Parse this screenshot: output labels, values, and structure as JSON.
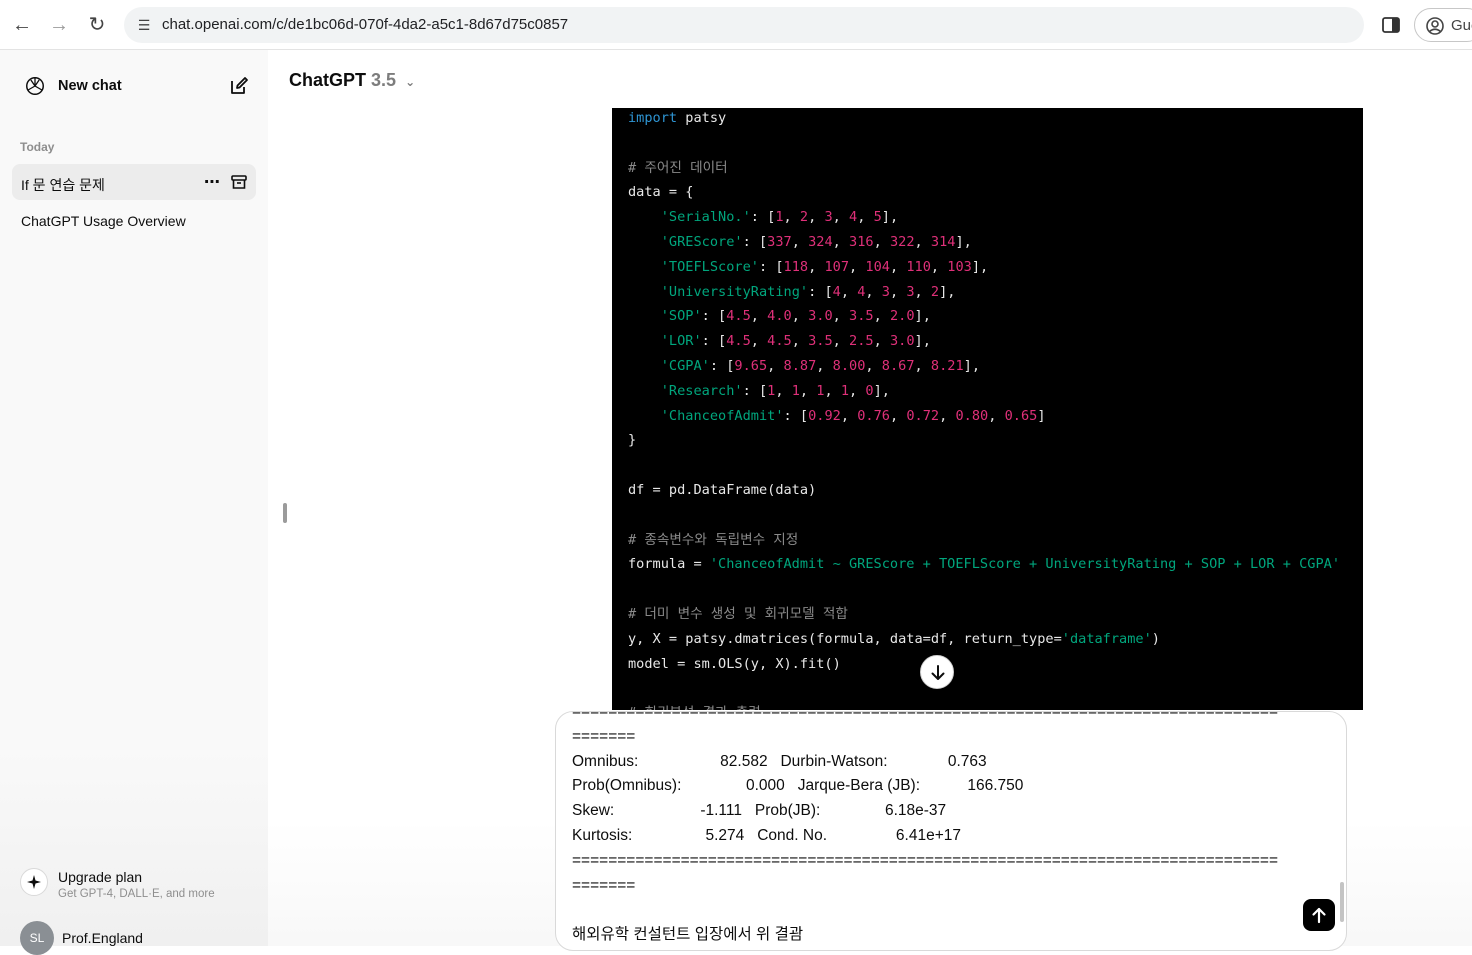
{
  "browser": {
    "url": "chat.openai.com/c/de1bc06d-070f-4da2-a5c1-8d67d75c0857",
    "profile_label": "Gue"
  },
  "sidebar": {
    "new_chat_label": "New chat",
    "section_today": "Today",
    "conversations": [
      {
        "title": "If 문 연습 문제"
      },
      {
        "title": "ChatGPT Usage Overview"
      }
    ],
    "upgrade_title": "Upgrade plan",
    "upgrade_sub": "Get GPT-4, DALL·E, and more",
    "user_initials": "SL",
    "user_name": "Prof.England"
  },
  "header": {
    "model_name": "ChatGPT",
    "model_version": "3.5"
  },
  "code": {
    "lines": [
      "import patsy",
      "",
      "# 주어진 데이터",
      "data = {",
      "    'SerialNo.': [1, 2, 3, 4, 5],",
      "    'GREScore': [337, 324, 316, 322, 314],",
      "    'TOEFLScore': [118, 107, 104, 110, 103],",
      "    'UniversityRating': [4, 4, 3, 3, 2],",
      "    'SOP': [4.5, 4.0, 3.0, 3.5, 2.0],",
      "    'LOR': [4.5, 4.5, 3.5, 2.5, 3.0],",
      "    'CGPA': [9.65, 8.87, 8.00, 8.67, 8.21],",
      "    'Research': [1, 1, 1, 1, 0],",
      "    'ChanceofAdmit': [0.92, 0.76, 0.72, 0.80, 0.65]",
      "}",
      "",
      "df = pd.DataFrame(data)",
      "",
      "# 종속변수와 독립변수 지정",
      "formula = 'ChanceofAdmit ~ GREScore + TOEFLScore + UniversityRating + SOP + LOR + CGPA'",
      "",
      "# 더미 변수 생성 및 회귀모델 적합",
      "y, X = patsy.dmatrices(formula, data=df, return_type='dataframe')",
      "model = sm.OLS(y, X).fit()",
      "",
      "# 회귀분석 결과 출력"
    ]
  },
  "composer": {
    "lines": [
      "==============================================================================",
      "=======",
      "Omnibus:                   82.582   Durbin-Watson:              0.763",
      "Prob(Omnibus):               0.000   Jarque-Bera (JB):           166.750",
      "Skew:                    -1.111   Prob(JB):               6.18e-37",
      "Kurtosis:                 5.274   Cond. No.                6.41e+17",
      "==============================================================================",
      "=======",
      "",
      "해외유학 컨설턴트 입장에서 위 결괌"
    ]
  }
}
